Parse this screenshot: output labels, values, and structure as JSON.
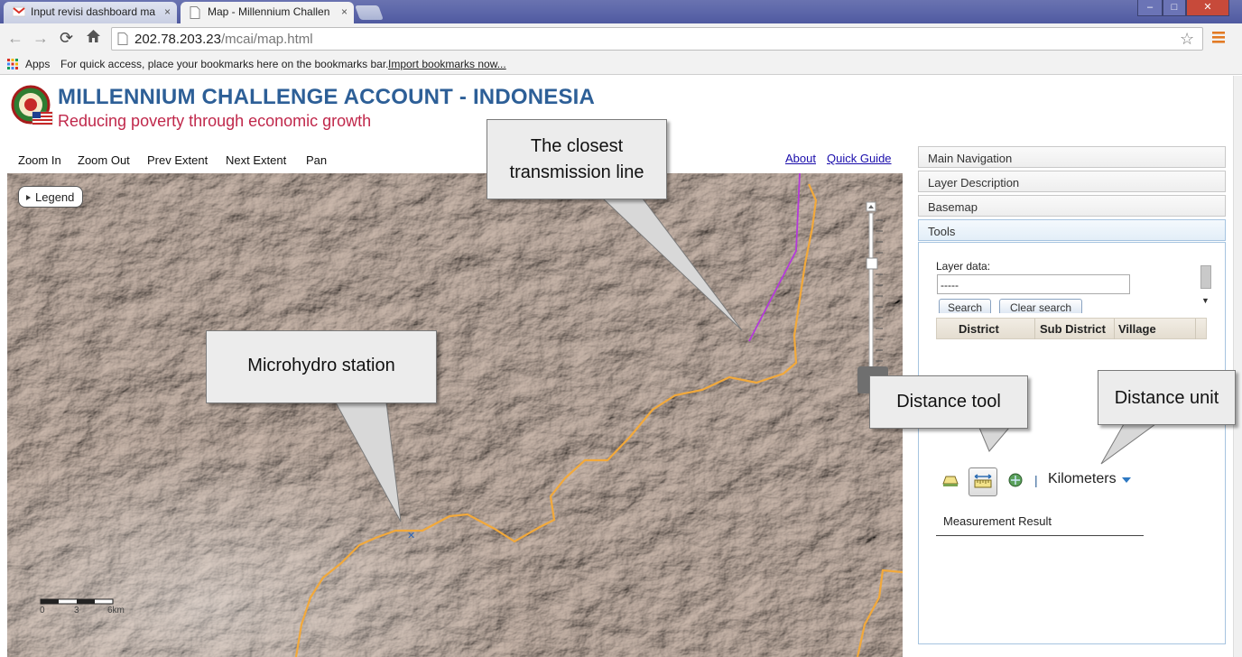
{
  "browser": {
    "tabs": [
      {
        "title": "Input revisi dashboard ma",
        "icon": "gmail-icon",
        "active": false
      },
      {
        "title": "Map - Millennium Challen",
        "icon": "page-icon",
        "active": true
      }
    ],
    "close_glyph": "×",
    "url_host": "202.78.203.23",
    "url_path": "/mcai/map.html",
    "bookmarks": {
      "apps_label": "Apps",
      "hint": "For quick access, place your bookmarks here on the bookmarks bar.",
      "import_link": "Import bookmarks now..."
    },
    "window_buttons": [
      "–",
      "□",
      "✕"
    ]
  },
  "header": {
    "title": "MILLENNIUM CHALLENGE ACCOUNT - INDONESIA",
    "tagline": "Reducing poverty through economic growth"
  },
  "map_toolbar": {
    "zoom_in": "Zoom In",
    "zoom_out": "Zoom Out",
    "prev_extent": "Prev Extent",
    "next_extent": "Next Extent",
    "pan": "Pan",
    "about": "About",
    "quick_guide": "Quick Guide"
  },
  "map": {
    "legend_label": "Legend",
    "scalebar_labels": [
      "0",
      "3",
      "6km"
    ],
    "colors": {
      "river": "#f2a93b",
      "transmission": "#b43ad9",
      "terrain": "#cdbfb6"
    }
  },
  "callouts": {
    "transmission": [
      "The closest",
      "transmission line"
    ],
    "microhydro": "Microhydro station",
    "distance_tool": "Distance tool",
    "distance_unit": "Distance unit"
  },
  "panel": {
    "accordion": [
      "Main Navigation",
      "Layer Description",
      "Basemap",
      "Tools"
    ],
    "layer_data_label": "Layer data:",
    "layer_data_value": "-----",
    "search_label": "Search",
    "clear_search_label": "Clear search",
    "grid_columns": [
      "District",
      "Sub District",
      "Village"
    ],
    "unit_separator": "|",
    "unit": "Kilometers",
    "measurement_result": "Measurement Result"
  }
}
